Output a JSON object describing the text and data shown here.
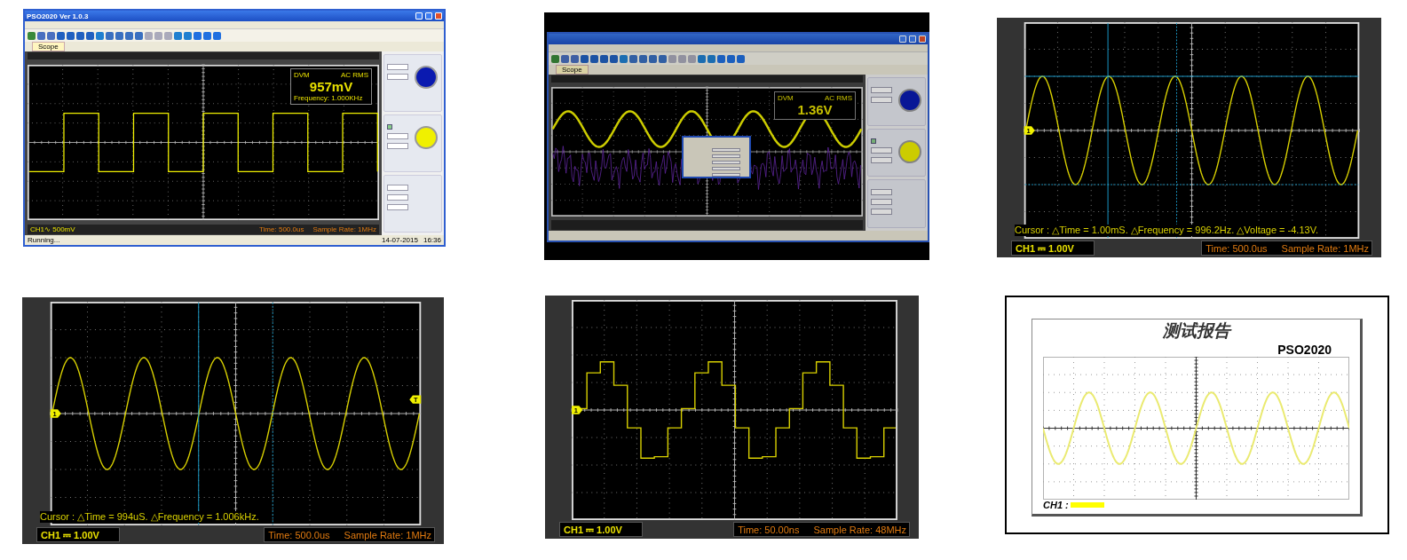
{
  "panels": [
    {
      "kind": "app_window",
      "title": "PSO2020 Ver 1.0.3",
      "tab": "Scope",
      "trace": {
        "kind": "square"
      },
      "ch1_checked": true,
      "dvm": {
        "label": "DVM",
        "mode": "AC RMS",
        "value": "957mV",
        "frequency": "Frequency: 1.000KHz"
      },
      "channel": "CH1∿ 500mV",
      "time": "Time: 500.0us",
      "sample_rate": "Sample Rate: 1MHz",
      "status": "Running...",
      "date": "14-07-2015",
      "clock": "16:36"
    },
    {
      "kind": "app_window",
      "framed": true,
      "tab": "Scope",
      "trace": {
        "kind": "sine"
      },
      "spectrum": true,
      "dialog_open": true,
      "ch1_checked": true,
      "dvm": {
        "label": "DVM",
        "mode": "AC RMS",
        "value": "1.36V"
      }
    },
    {
      "kind": "scope",
      "trace": {
        "kind": "sine"
      },
      "cursors": [
        {
          "kind": "time"
        },
        {
          "kind": "time_ref"
        },
        {
          "kind": "voltage"
        },
        {
          "kind": "voltage_ref"
        }
      ],
      "cursor_readout": "Cursor : △Time = 1.00mS. △Frequency = 996.2Hz. △Voltage = -4.13V.",
      "channel_marker": "1",
      "channel": "CH1 ⎓  1.00V",
      "time": "Time: 500.0us",
      "sample_rate": "Sample Rate: 1MHz"
    },
    {
      "kind": "scope",
      "trace": {
        "kind": "sine"
      },
      "cursors": [
        {
          "kind": "time"
        },
        {
          "kind": "time_ref"
        }
      ],
      "cursor_readout": "Cursor : △Time = 994uS. △Frequency = 1.006kHz.",
      "channel_marker": "1",
      "trigger_marker": "T",
      "channel": "CH1 ⎓  1.00V",
      "time": "Time: 500.0us",
      "sample_rate": "Sample Rate: 1MHz"
    },
    {
      "kind": "scope",
      "trace": {
        "kind": "stepped"
      },
      "channel_marker": "1",
      "channel": "CH1 ⎓  1.00V",
      "time": "Time: 50.00ns",
      "sample_rate": "Sample Rate: 48MHz"
    },
    {
      "kind": "report",
      "title": "测试报告",
      "model": "PSO2020",
      "trace": {
        "kind": "sine"
      },
      "channel_label": "CH1 :"
    }
  ]
}
